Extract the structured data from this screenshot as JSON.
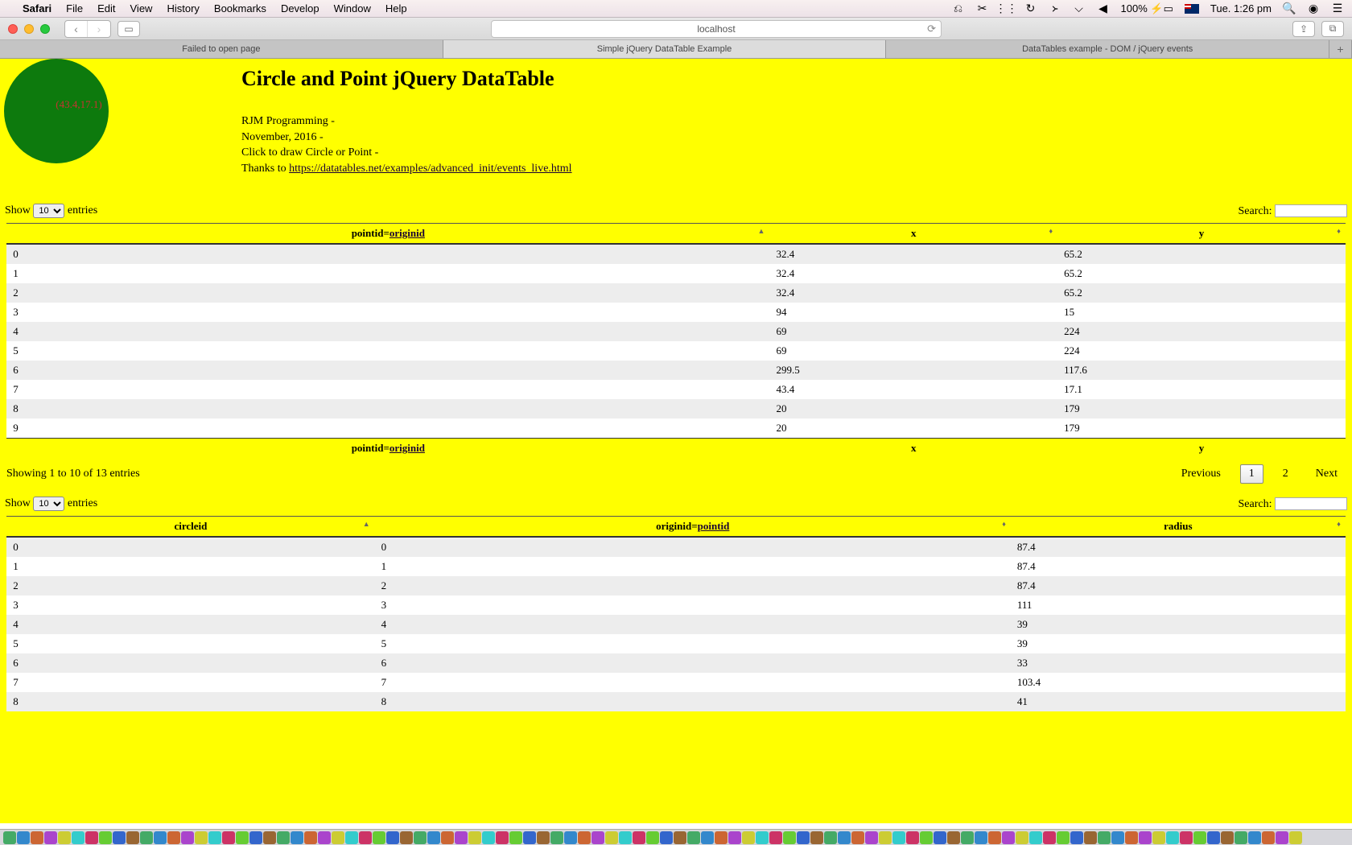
{
  "menubar": {
    "app": "Safari",
    "items": [
      "File",
      "Edit",
      "View",
      "History",
      "Bookmarks",
      "Develop",
      "Window",
      "Help"
    ],
    "battery": "100%",
    "clock": "Tue. 1:26 pm"
  },
  "toolbar": {
    "url": "localhost"
  },
  "tabs": [
    {
      "label": "Failed to open page",
      "active": false
    },
    {
      "label": "Simple jQuery DataTable Example",
      "active": true
    },
    {
      "label": "DataTables example - DOM / jQuery events",
      "active": false
    }
  ],
  "page": {
    "circle_label": "(43.4,17.1)",
    "title": "Circle and Point jQuery DataTable",
    "sub1": "RJM Programming -",
    "sub2": "November, 2016 -",
    "sub3": "Click to draw Circle or Point -",
    "sub4_prefix": "Thanks to ",
    "sub4_link": "https://datatables.net/examples/advanced_init/events_live.html"
  },
  "common": {
    "show_label": "Show ",
    "entries_label": " entries",
    "entries_value": "10",
    "search_label": "Search:"
  },
  "table1": {
    "head_pointid_prefix": "pointid=",
    "head_pointid_link": "originid",
    "head_x": "x",
    "head_y": "y",
    "rows": [
      {
        "id": "0",
        "x": "32.4",
        "y": "65.2"
      },
      {
        "id": "1",
        "x": "32.4",
        "y": "65.2"
      },
      {
        "id": "2",
        "x": "32.4",
        "y": "65.2"
      },
      {
        "id": "3",
        "x": "94",
        "y": "15"
      },
      {
        "id": "4",
        "x": "69",
        "y": "224"
      },
      {
        "id": "5",
        "x": "69",
        "y": "224"
      },
      {
        "id": "6",
        "x": "299.5",
        "y": "117.6"
      },
      {
        "id": "7",
        "x": "43.4",
        "y": "17.1"
      },
      {
        "id": "8",
        "x": "20",
        "y": "179"
      },
      {
        "id": "9",
        "x": "20",
        "y": "179"
      }
    ],
    "info": "Showing 1 to 10 of 13 entries",
    "pager": {
      "previous": "Previous",
      "p1": "1",
      "p2": "2",
      "next": "Next"
    }
  },
  "table2": {
    "head_circleid": "circleid",
    "head_originid_prefix": "originid=",
    "head_originid_link": "pointid",
    "head_radius": "radius",
    "rows": [
      {
        "c": "0",
        "o": "0",
        "r": "87.4"
      },
      {
        "c": "1",
        "o": "1",
        "r": "87.4"
      },
      {
        "c": "2",
        "o": "2",
        "r": "87.4"
      },
      {
        "c": "3",
        "o": "3",
        "r": "111"
      },
      {
        "c": "4",
        "o": "4",
        "r": "39"
      },
      {
        "c": "5",
        "o": "5",
        "r": "39"
      },
      {
        "c": "6",
        "o": "6",
        "r": "33"
      },
      {
        "c": "7",
        "o": "7",
        "r": "103.4"
      },
      {
        "c": "8",
        "o": "8",
        "r": "41"
      }
    ]
  }
}
